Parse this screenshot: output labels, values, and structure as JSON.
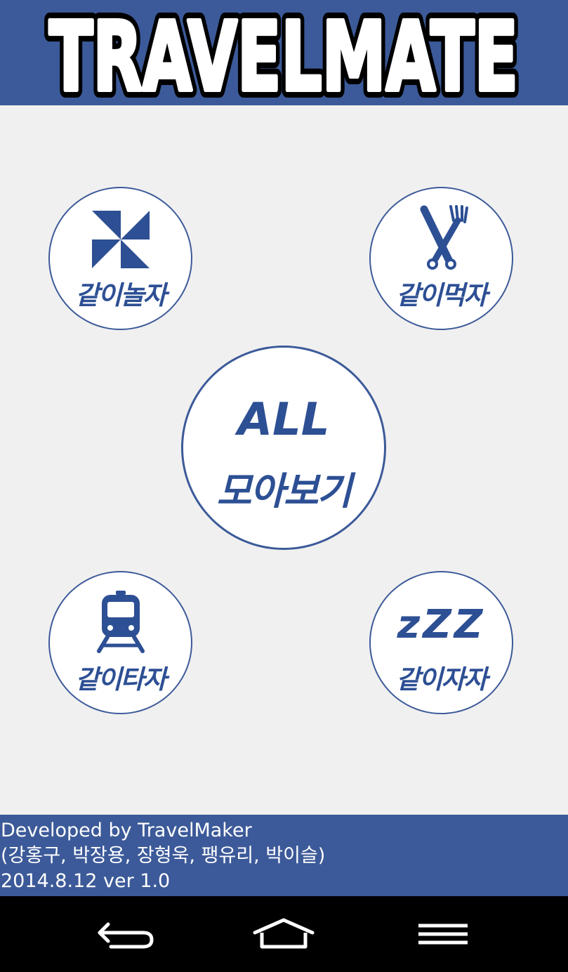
{
  "header": {
    "title": "TRAVELMATE"
  },
  "menu": {
    "play": {
      "label": "같이놀자",
      "icon": "pinwheel-icon"
    },
    "eat": {
      "label": "같이먹자",
      "icon": "fork-knife-icon"
    },
    "all": {
      "title": "ALL",
      "label": "모아보기"
    },
    "ride": {
      "label": "같이타자",
      "icon": "train-icon"
    },
    "sleep": {
      "label": "같이자자",
      "zzz": "zZZ",
      "icon": "zzz-icon"
    }
  },
  "footer": {
    "line1": "Developed by TravelMaker",
    "line2": "(강홍구, 박장용, 장형욱, 팽유리, 박이슬)",
    "line3": "2014.8.12 ver 1.0"
  },
  "navbar": {
    "back_icon": "back-arrow-icon",
    "home_icon": "home-icon",
    "menu_icon": "menu-icon"
  },
  "colors": {
    "brand": "#3c5a99",
    "icon_blue": "#2d4f94",
    "background": "#f0f0f0"
  }
}
